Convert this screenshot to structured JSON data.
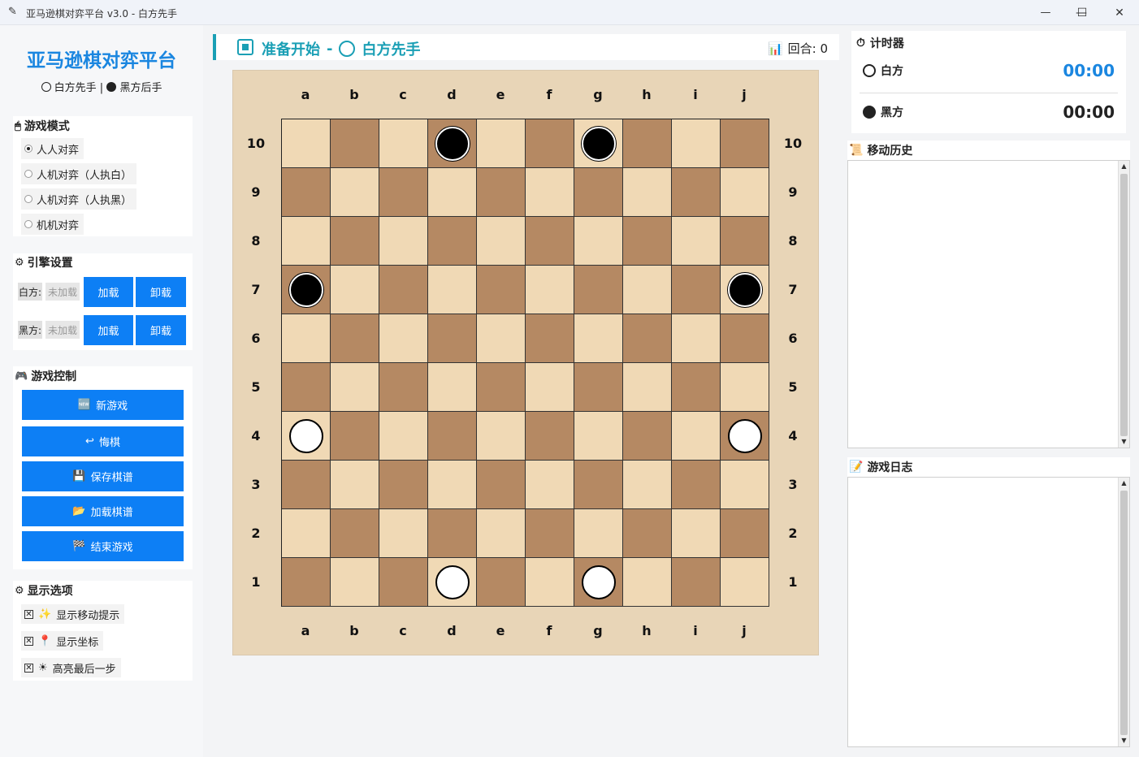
{
  "window": {
    "title": "亚马逊棋对弈平台 v3.0 - 白方先手",
    "icon": "feather-icon",
    "minimize": "—",
    "maximize": "☐",
    "close": "✕"
  },
  "sidebar": {
    "app_title": "亚马逊棋对弈平台",
    "subtitle_white": "白方先手",
    "subtitle_sep": "|",
    "subtitle_black": "黑方后手",
    "game_mode": {
      "title": "游戏模式",
      "options": [
        {
          "label": "人人对弈",
          "selected": true
        },
        {
          "label": "人机对弈（人执白）",
          "selected": false
        },
        {
          "label": "人机对弈（人执黑）",
          "selected": false
        },
        {
          "label": "机机对弈",
          "selected": false
        }
      ]
    },
    "engine": {
      "title": "引擎设置",
      "white_label": "白方:",
      "black_label": "黑方:",
      "white_status": "未加载",
      "black_status": "未加载",
      "load_label": "加载",
      "unload_label": "卸载"
    },
    "control": {
      "title": "游戏控制",
      "new_game": "新游戏",
      "undo": "悔棋",
      "save": "保存棋谱",
      "load": "加载棋谱",
      "end": "结束游戏"
    },
    "display": {
      "title": "显示选项",
      "options": [
        {
          "label": "显示移动提示",
          "checked": true,
          "icon": "sparkle-icon"
        },
        {
          "label": "显示坐标",
          "checked": true,
          "icon": "pin-icon"
        },
        {
          "label": "高亮最后一步",
          "checked": true,
          "icon": "sun-icon"
        }
      ]
    }
  },
  "status": {
    "state": "准备开始",
    "dash": "-",
    "turn": "白方先手",
    "round_label": "回合: 0"
  },
  "board": {
    "files": [
      "a",
      "b",
      "c",
      "d",
      "e",
      "f",
      "g",
      "h",
      "i",
      "j"
    ],
    "ranks": [
      "10",
      "9",
      "8",
      "7",
      "6",
      "5",
      "4",
      "3",
      "2",
      "1"
    ],
    "light_color": "#f0d9b5",
    "dark_color": "#b58963",
    "pieces": [
      {
        "square": "d10",
        "color": "black"
      },
      {
        "square": "g10",
        "color": "black"
      },
      {
        "square": "a7",
        "color": "black"
      },
      {
        "square": "j7",
        "color": "black"
      },
      {
        "square": "a4",
        "color": "white"
      },
      {
        "square": "j4",
        "color": "white"
      },
      {
        "square": "d1",
        "color": "white"
      },
      {
        "square": "g1",
        "color": "white"
      }
    ]
  },
  "timer": {
    "title": "计时器",
    "white_label": "白方",
    "white_time": "00:00",
    "white_color": "#1a86e0",
    "black_label": "黑方",
    "black_time": "00:00"
  },
  "history": {
    "title": "移动历史"
  },
  "log": {
    "title": "游戏日志"
  }
}
